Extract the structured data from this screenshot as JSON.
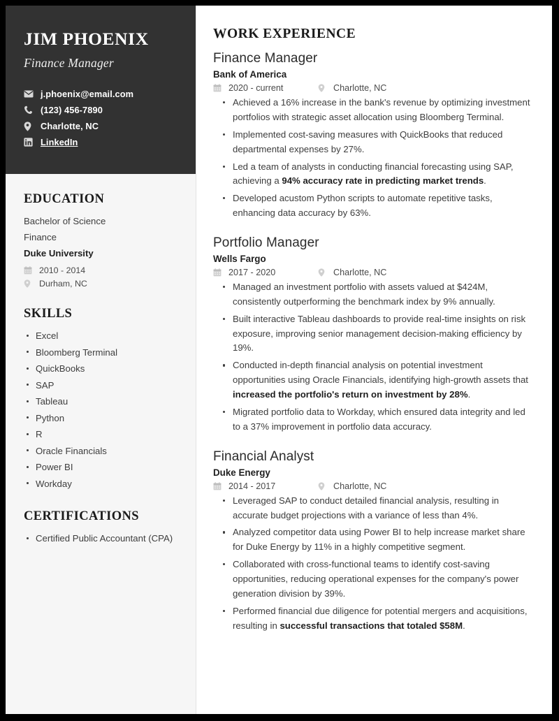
{
  "header": {
    "name": "JIM PHOENIX",
    "title": "Finance Manager",
    "contacts": [
      {
        "icon": "envelope-icon",
        "text": "j.phoenix@email.com",
        "link": false
      },
      {
        "icon": "phone-icon",
        "text": "(123) 456-7890",
        "link": false
      },
      {
        "icon": "location-pin-icon",
        "text": "Charlotte, NC",
        "link": false
      },
      {
        "icon": "linkedin-icon",
        "text": "LinkedIn",
        "link": true
      }
    ]
  },
  "education": {
    "heading": "EDUCATION",
    "degree": "Bachelor of Science",
    "field": "Finance",
    "school": "Duke University",
    "dates": "2010 - 2014",
    "location": "Durham, NC"
  },
  "skills": {
    "heading": "SKILLS",
    "items": [
      "Excel",
      "Bloomberg Terminal",
      "QuickBooks",
      "SAP",
      "Tableau",
      "Python",
      "R",
      "Oracle Financials",
      "Power BI",
      "Workday"
    ]
  },
  "certifications": {
    "heading": "CERTIFICATIONS",
    "items": [
      "Certified Public Accountant (CPA)"
    ]
  },
  "work_experience": {
    "heading": "WORK EXPERIENCE",
    "jobs": [
      {
        "title": "Finance Manager",
        "company": "Bank of America",
        "dates": "2020 - current",
        "location": "Charlotte, NC",
        "bullets": [
          {
            "text": "Achieved a 16% increase in the bank's revenue by optimizing investment portfolios with strategic asset allocation using Bloomberg Terminal."
          },
          {
            "text": "Implemented cost-saving measures with QuickBooks that reduced departmental expenses by 27%."
          },
          {
            "pre": "Led a team of analysts in conducting financial forecasting using SAP, achieving a ",
            "bold": "94% accuracy rate in predicting market trends",
            "post": "."
          },
          {
            "text": "Developed acustom Python scripts to automate repetitive tasks, enhancing data accuracy by 63%."
          }
        ]
      },
      {
        "title": "Portfolio Manager",
        "company": "Wells Fargo",
        "dates": "2017 - 2020",
        "location": "Charlotte, NC",
        "bullets": [
          {
            "text": "Managed an investment portfolio with assets valued at $424M, consistently outperforming the benchmark index by 9% annually."
          },
          {
            "text": "Built interactive Tableau dashboards to provide real-time insights on risk exposure, improving senior management decision-making efficiency by 19%."
          },
          {
            "pre": "Conducted in-depth financial analysis on potential investment opportunities using Oracle Financials, identifying high-growth assets that ",
            "bold": "increased the portfolio's return on investment by 28%",
            "post": "."
          },
          {
            "text": "Migrated portfolio data to Workday, which ensured data integrity and led to a 37% improvement in portfolio data accuracy."
          }
        ]
      },
      {
        "title": "Financial Analyst",
        "company": "Duke Energy",
        "dates": "2014 - 2017",
        "location": "Charlotte, NC",
        "bullets": [
          {
            "text": "Leveraged SAP to conduct detailed financial analysis, resulting in accurate budget projections with a variance of less than 4%."
          },
          {
            "text": "Analyzed competitor data using Power BI to help increase market share for Duke Energy by 11% in a highly competitive segment."
          },
          {
            "text": "Collaborated with cross-functional teams to identify cost-saving opportunities, reducing operational expenses for the company's power generation division by 39%."
          },
          {
            "pre": "Performed financial due diligence for potential mergers and acquisitions, resulting in ",
            "bold": "successful transactions that totaled $58M",
            "post": "."
          }
        ]
      }
    ]
  },
  "colors": {
    "header_background": "#323232",
    "sidebar_background": "#f6f6f6",
    "page_background": "#ffffff",
    "frame": "#000000",
    "body_text": "#3d3d3d",
    "heading_text": "#1a1a1a"
  }
}
